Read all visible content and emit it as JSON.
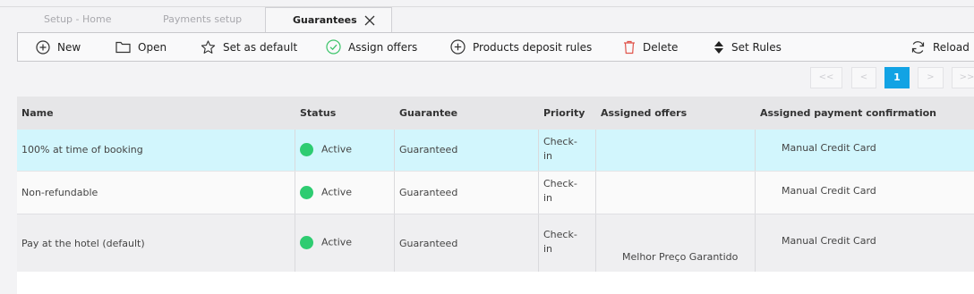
{
  "tabs": {
    "home": "Setup - Home",
    "payments": "Payments setup",
    "active": "Guarantees"
  },
  "toolbar": {
    "new": "New",
    "open": "Open",
    "set_default": "Set as default",
    "assign_offers": "Assign offers",
    "deposit_rules": "Products deposit rules",
    "delete": "Delete",
    "set_rules": "Set Rules",
    "reload": "Reload"
  },
  "pager": {
    "first": "<<",
    "prev": "<",
    "current": "1",
    "next": ">",
    "last": ">>"
  },
  "columns": {
    "name": "Name",
    "status": "Status",
    "guarantee": "Guarantee",
    "priority": "Priority",
    "assigned_offers": "Assigned offers",
    "assigned_payment": "Assigned payment confirmation"
  },
  "rows": [
    {
      "name": "100% at time of booking",
      "status": "Active",
      "guarantee": "Guaranteed",
      "priority_1": "Check-",
      "priority_2": "in",
      "offers": "",
      "payment": "Manual Credit Card"
    },
    {
      "name": "Non-refundable",
      "status": "Active",
      "guarantee": "Guaranteed",
      "priority_1": "Check-",
      "priority_2": "in",
      "offers": "",
      "payment": "Manual Credit Card"
    },
    {
      "name": "Pay at the hotel (default)",
      "status": "Active",
      "guarantee": "Guaranteed",
      "priority_1": "Check-",
      "priority_2": "in",
      "offers": "Melhor Preço Garantido",
      "payment": "Manual Credit Card"
    }
  ],
  "colors": {
    "selected_row": "#d2f6fd",
    "active_dot": "#2ecc71",
    "pager_current": "#12a3e4"
  }
}
